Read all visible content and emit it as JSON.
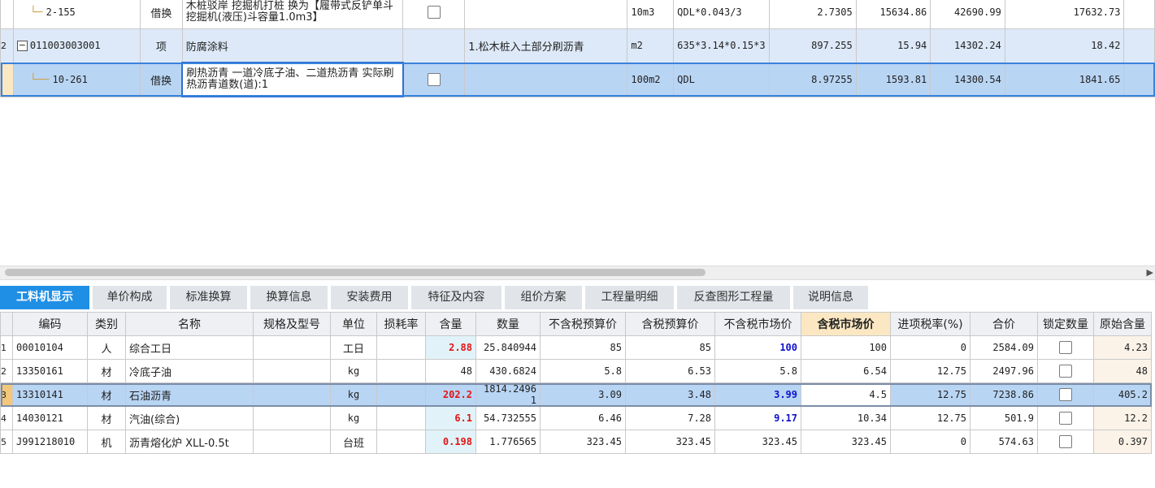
{
  "upper_rows": [
    {
      "num": "",
      "code": "2-155",
      "type": "借换",
      "name": "木桩驳岸 挖掘机打桩  换为【履带式反铲单斗挖掘机(液压)斗容量1.0m3】",
      "feature": "",
      "unit": "10m3",
      "expr": "QDL*0.043/3",
      "qty": "2.7305",
      "price": "15634.86",
      "total": "42690.99",
      "extra": "17632.73"
    },
    {
      "num": "2",
      "code": "011003003001",
      "type": "项",
      "name": "防腐涂料",
      "feature": "1.松木桩入土部分刷沥青",
      "unit": "m2",
      "expr": "635*3.14*0.15*3",
      "qty": "897.255",
      "price": "15.94",
      "total": "14302.24",
      "extra": "18.42"
    },
    {
      "num": "",
      "code": "10-261",
      "type": "借换",
      "name": "刷热沥青 一道冷底子油、二道热沥青 实际刷热沥青道数(道):1",
      "feature": "",
      "unit": "100m2",
      "expr": "QDL",
      "qty": "8.97255",
      "price": "1593.81",
      "total": "14300.54",
      "extra": "1841.65"
    }
  ],
  "tabs": [
    "工料机显示",
    "单价构成",
    "标准换算",
    "换算信息",
    "安装费用",
    "特征及内容",
    "组价方案",
    "工程量明细",
    "反查图形工程量",
    "说明信息"
  ],
  "columns": [
    "编码",
    "类别",
    "名称",
    "规格及型号",
    "单位",
    "损耗率",
    "含量",
    "数量",
    "不含税预算价",
    "含税预算价",
    "不含税市场价",
    "含税市场价",
    "进项税率(%)",
    "合价",
    "锁定数量",
    "原始含量"
  ],
  "lower_rows": [
    {
      "num": "1",
      "code": "00010104",
      "cat": "人",
      "name": "综合工日",
      "spec": "",
      "unit": "工日",
      "loss": "",
      "content": "2.88",
      "qty": "25.840944",
      "pre_ex": "85",
      "pre_in": "85",
      "mkt_ex": "100",
      "mkt_in": "100",
      "tax": "0",
      "total": "2584.09",
      "orig": "4.23"
    },
    {
      "num": "2",
      "code": "13350161",
      "cat": "材",
      "name": "冷底子油",
      "spec": "",
      "unit": "kg",
      "loss": "",
      "content": "48",
      "qty": "430.6824",
      "pre_ex": "5.8",
      "pre_in": "6.53",
      "mkt_ex": "5.8",
      "mkt_in": "6.54",
      "tax": "12.75",
      "total": "2497.96",
      "orig": "48"
    },
    {
      "num": "3",
      "code": "13310141",
      "cat": "材",
      "name": "石油沥青",
      "spec": "",
      "unit": "kg",
      "loss": "",
      "content": "202.2",
      "qty": "1814.2496 1",
      "pre_ex": "3.09",
      "pre_in": "3.48",
      "mkt_ex": "3.99",
      "mkt_in": "4.5",
      "tax": "12.75",
      "total": "7238.86",
      "orig": "405.2"
    },
    {
      "num": "4",
      "code": "14030121",
      "cat": "材",
      "name": "汽油(综合)",
      "spec": "",
      "unit": "kg",
      "loss": "",
      "content": "6.1",
      "qty": "54.732555",
      "pre_ex": "6.46",
      "pre_in": "7.28",
      "mkt_ex": "9.17",
      "mkt_in": "10.34",
      "tax": "12.75",
      "total": "501.9",
      "orig": "12.2"
    },
    {
      "num": "5",
      "code": "J991218010",
      "cat": "机",
      "name": "沥青熔化炉 XLL-0.5t",
      "spec": "",
      "unit": "台班",
      "loss": "",
      "content": "0.198",
      "qty": "1.776565",
      "pre_ex": "323.45",
      "pre_in": "323.45",
      "mkt_ex": "323.45",
      "mkt_in": "323.45",
      "tax": "0",
      "total": "574.63",
      "orig": "0.397"
    }
  ],
  "colors": {
    "active_tab": "#1f8fe6",
    "selected_row": "#b9d5f4",
    "red_content": "#e31414",
    "blue_price": "#1010d0"
  }
}
